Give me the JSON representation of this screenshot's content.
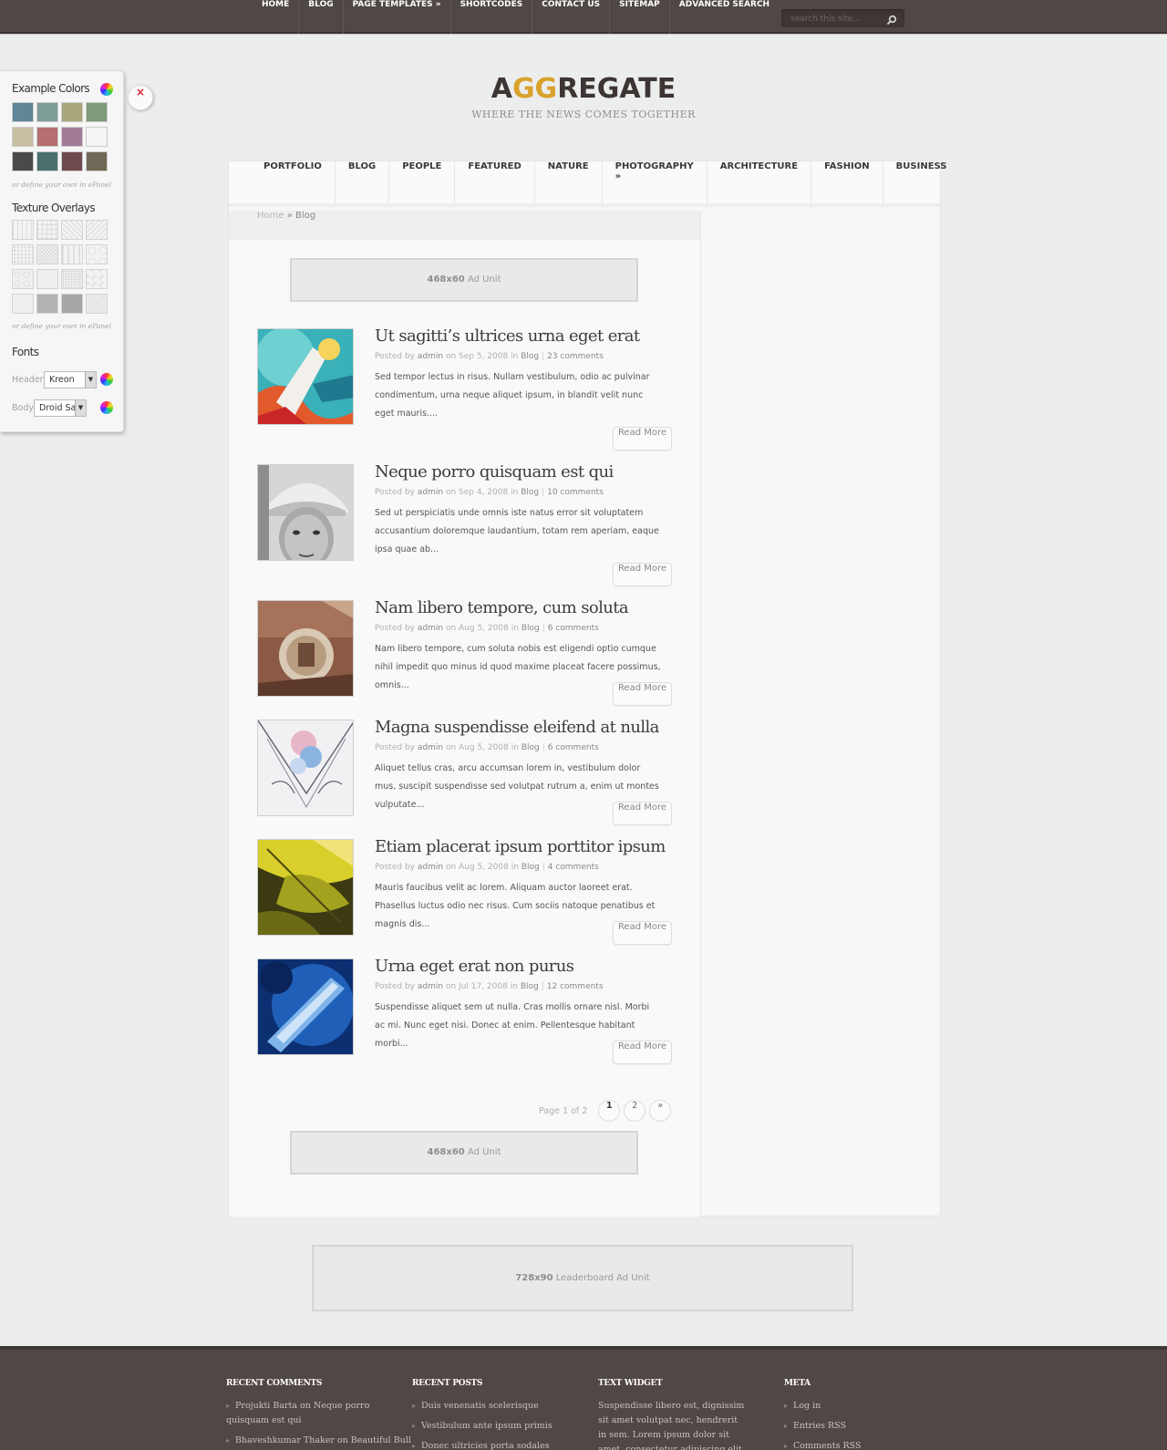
{
  "topnav": [
    "HOME",
    "BLOG",
    "PAGE TEMPLATES »",
    "SHORTCODES",
    "CONTACT US",
    "SITEMAP",
    "ADVANCED SEARCH"
  ],
  "search": {
    "placeholder": "search this site..."
  },
  "logo": {
    "pre": "A",
    "gg": "GG",
    "post": "REGATE",
    "tagline": "WHERE THE NEWS COMES TOGETHER"
  },
  "catnav": [
    "PORTFOLIO",
    "BLOG",
    "PEOPLE",
    "FEATURED",
    "NATURE",
    "PHOTOGRAPHY »",
    "ARCHITECTURE",
    "FASHION",
    "BUSINESS"
  ],
  "breadcrumb": {
    "home": "Home",
    "sep": " » ",
    "current": "Blog"
  },
  "ads": {
    "top": {
      "size": "468x60",
      "label": "Ad Unit"
    },
    "bottom": {
      "size": "468x60",
      "label": "Ad Unit"
    },
    "leaderboard": {
      "size": "728x90",
      "label": "Leaderboard Ad Unit"
    }
  },
  "posts": [
    {
      "title": "Ut sagitti’s ultrices urna eget erat",
      "author": "admin",
      "date": "Sep 5, 2008",
      "category": "Blog",
      "comments": "23 comments",
      "excerpt": "Sed tempor lectus in risus. Nullam vestibulum, odio ac pulvinar condimentum, urna neque aliquet ipsum, in blandit velit nunc eget mauris....",
      "readmore": "Read More"
    },
    {
      "title": "Neque porro quisquam est qui",
      "author": "admin",
      "date": "Sep 4, 2008",
      "category": "Blog",
      "comments": "10 comments",
      "excerpt": "Sed ut perspiciatis unde omnis iste natus error sit voluptatem accusantium doloremque laudantium, totam rem aperiam, eaque ipsa quae ab...",
      "readmore": "Read More"
    },
    {
      "title": "Nam libero tempore, cum soluta",
      "author": "admin",
      "date": "Aug 5, 2008",
      "category": "Blog",
      "comments": "6 comments",
      "excerpt": "Nam libero tempore, cum soluta nobis est eligendi optio cumque nihil impedit quo minus id quod maxime placeat facere possimus, omnis...",
      "readmore": "Read More"
    },
    {
      "title": "Magna suspendisse eleifend at nulla",
      "author": "admin",
      "date": "Aug 5, 2008",
      "category": "Blog",
      "comments": "6 comments",
      "excerpt": "Aliquet tellus cras, arcu accumsan lorem in, vestibulum dolor mus, suscipit suspendisse sed volutpat rutrum a, enim ut montes vulputate...",
      "readmore": "Read More"
    },
    {
      "title": "Etiam placerat ipsum porttitor ipsum",
      "author": "admin",
      "date": "Aug 5, 2008",
      "category": "Blog",
      "comments": "4 comments",
      "excerpt": "Mauris faucibus velit ac lorem. Aliquam auctor laoreet erat. Phasellus luctus odio nec risus. Cum sociis natoque penatibus et magnis dis...",
      "readmore": "Read More"
    },
    {
      "title": "Urna eget erat non purus",
      "author": "admin",
      "date": "Jul 17, 2008",
      "category": "Blog",
      "comments": "12 comments",
      "excerpt": "Suspendisse aliquet sem ut nulla. Cras mollis ornare nisl. Morbi ac mi. Nunc eget nisi. Donec at enim. Pellentesque habitant morbi...",
      "readmore": "Read More"
    }
  ],
  "meta_words": {
    "posted_by": "Posted by",
    "on": "on",
    "in": "in",
    "sep": "|"
  },
  "pager": {
    "info": "Page 1 of 2",
    "pages": [
      "1",
      "2",
      "»"
    ]
  },
  "panel": {
    "colors_title": "Example Colors",
    "colors": [
      "#5f8796",
      "#7e9c98",
      "#a8a77a",
      "#7f9a7a",
      "#c8bea2",
      "#b56f6f",
      "#a17b96",
      "#f4f4f4",
      "#4a4a4c",
      "#4b6f6a",
      "#6e4a4e",
      "#6f6856"
    ],
    "colors_note": "or define your own in ePanel",
    "texture_title": "Texture Overlays",
    "texture_note": "or define your own in ePanel",
    "fonts_title": "Fonts",
    "header_label": "Header",
    "header_font": "Kreon",
    "body_label": "Body",
    "body_font": "Droid Sans",
    "close": "×"
  },
  "footer": {
    "recent_comments": {
      "title": "RECENT COMMENTS",
      "items": [
        "Projukti Barta on Neque porro quisquam est qui",
        "Bhaveshkumar Thaker on Beautiful Bull"
      ]
    },
    "recent_posts": {
      "title": "RECENT POSTS",
      "items": [
        "Duis venenatis scelerisque",
        "Vestibulum ante ipsum primis",
        "Donec ultricies porta sodales"
      ]
    },
    "text_widget": {
      "title": "TEXT WIDGET",
      "text": "Suspendisse libero est, dignissim sit amet volutpat nec, hendrerit in sem. Lorem ipsum dolor sit amet, consectetur adipiscing elit. Sed"
    },
    "meta": {
      "title": "META",
      "items": [
        "Log in",
        "Entries RSS",
        "Comments RSS"
      ]
    }
  }
}
